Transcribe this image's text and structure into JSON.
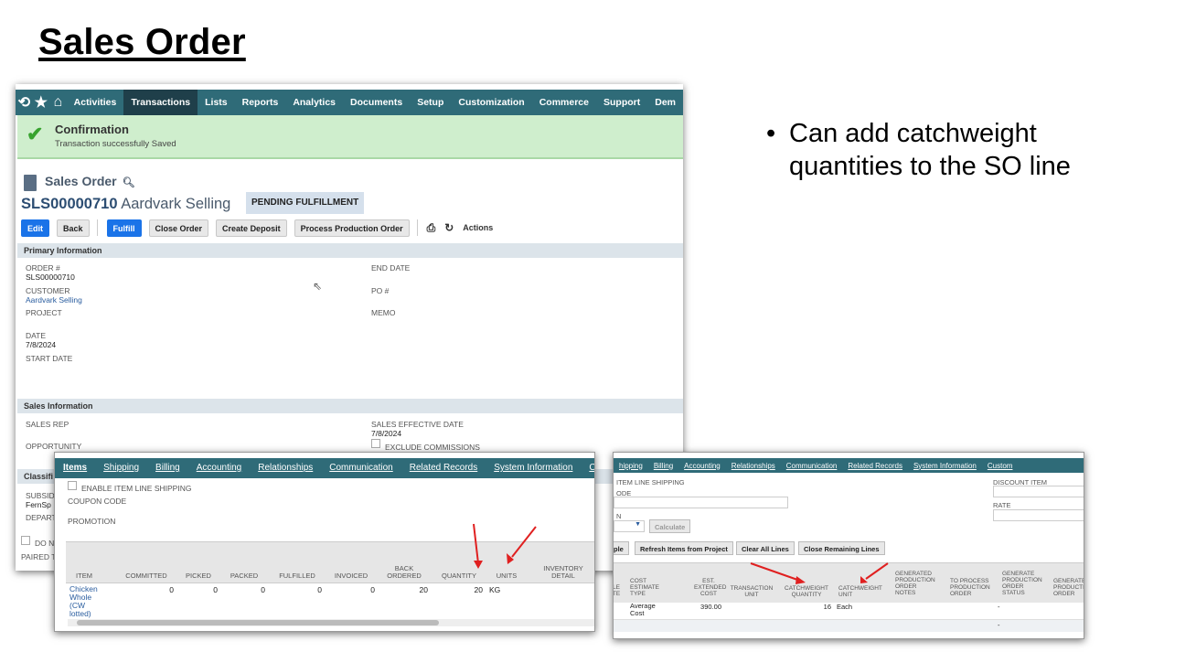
{
  "slide": {
    "title": "Sales Order",
    "bullet": "Can add catchweight quantities to the SO line"
  },
  "colors": {
    "nav": "#2f6b78",
    "confirm_bg": "#cfeecd",
    "primary_button": "#1a73e8",
    "arrow": "#e02020"
  },
  "nav": {
    "icons": [
      "recent-icon",
      "star-icon",
      "home-icon"
    ],
    "items": [
      "Activities",
      "Transactions",
      "Lists",
      "Reports",
      "Analytics",
      "Documents",
      "Setup",
      "Customization",
      "Commerce",
      "Support",
      "Dem"
    ],
    "active": "Transactions"
  },
  "confirmation": {
    "title": "Confirmation",
    "message": "Transaction successfully Saved"
  },
  "record": {
    "type": "Sales Order",
    "number": "SLS00000710",
    "entity": "Aardvark Selling",
    "status": "PENDING FULFILLMENT"
  },
  "buttons": {
    "edit": "Edit",
    "back": "Back",
    "fulfill": "Fulfill",
    "close_order": "Close Order",
    "create_deposit": "Create Deposit",
    "process_production_order": "Process Production Order",
    "actions": "Actions"
  },
  "primary": {
    "header": "Primary Information",
    "order_label": "ORDER #",
    "order_value": "SLS00000710",
    "customer_label": "CUSTOMER",
    "customer_value": "Aardvark Selling",
    "project_label": "PROJECT",
    "date_label": "DATE",
    "date_value": "7/8/2024",
    "start_date_label": "START DATE",
    "end_date_label": "END DATE",
    "po_label": "PO #",
    "memo_label": "MEMO"
  },
  "sales": {
    "header": "Sales Information",
    "rep_label": "SALES REP",
    "opportunity_label": "OPPORTUNITY",
    "effective_label": "SALES EFFECTIVE DATE",
    "effective_value": "7/8/2024",
    "exclude_label": "EXCLUDE COMMISSIONS"
  },
  "classification": {
    "header": "Classifi",
    "subsid": "SUBSID",
    "subsid_value": "FernSp",
    "depart": "DEPART",
    "do_not": "DO N",
    "paired": "PAIRED T"
  },
  "items_panel": {
    "tabs": [
      "Items",
      "Shipping",
      "Billing",
      "Accounting",
      "Relationships",
      "Communication",
      "Related Records",
      "System Information",
      "Cu"
    ],
    "enable_shipping": "ENABLE ITEM LINE SHIPPING",
    "coupon": "COUPON CODE",
    "promotion": "PROMOTION",
    "columns": [
      "ITEM",
      "COMMITTED",
      "PICKED",
      "PACKED",
      "FULFILLED",
      "INVOICED",
      "BACK ORDERED",
      "QUANTITY",
      "UNITS",
      "INVENTORY DETAIL"
    ],
    "row": {
      "item": "Chicken Whole (CW lotted)",
      "committed": "0",
      "picked": "0",
      "packed": "0",
      "fulfilled": "0",
      "invoiced": "0",
      "back_ordered": "20",
      "quantity": "20",
      "units": "KG"
    }
  },
  "right_panel": {
    "tabs": [
      "hipping",
      "Billing",
      "Accounting",
      "Relationships",
      "Communication",
      "Related Records",
      "System Information",
      "Custom"
    ],
    "item_line_shipping": "ITEM LINE SHIPPING",
    "ode": "ODE",
    "n": "N",
    "calculate": "Calculate",
    "discount_item": "DISCOUNT ITEM",
    "rate": "RATE",
    "buttons": [
      "ple",
      "Refresh Items from Project",
      "Clear All Lines",
      "Close Remaining Lines"
    ],
    "columns": [
      "LE TE",
      "COST ESTIMATE TYPE",
      "EST. EXTENDED COST",
      "TRANSACTION UNIT",
      "CATCHWEIGHT QUANTITY",
      "CATCHWEIGHT UNIT",
      "GENERATED PRODUCTION ORDER NOTES",
      "TO PROCESS PRODUCTION ORDER",
      "GENERATE PRODUCTION ORDER STATUS",
      "GENERATE PRODUCTI ORDER"
    ],
    "row": {
      "cost_type": "Average Cost",
      "est_cost": "390.00",
      "cw_qty": "16",
      "cw_unit": "Each",
      "status": "-"
    },
    "row2_status": "-"
  }
}
